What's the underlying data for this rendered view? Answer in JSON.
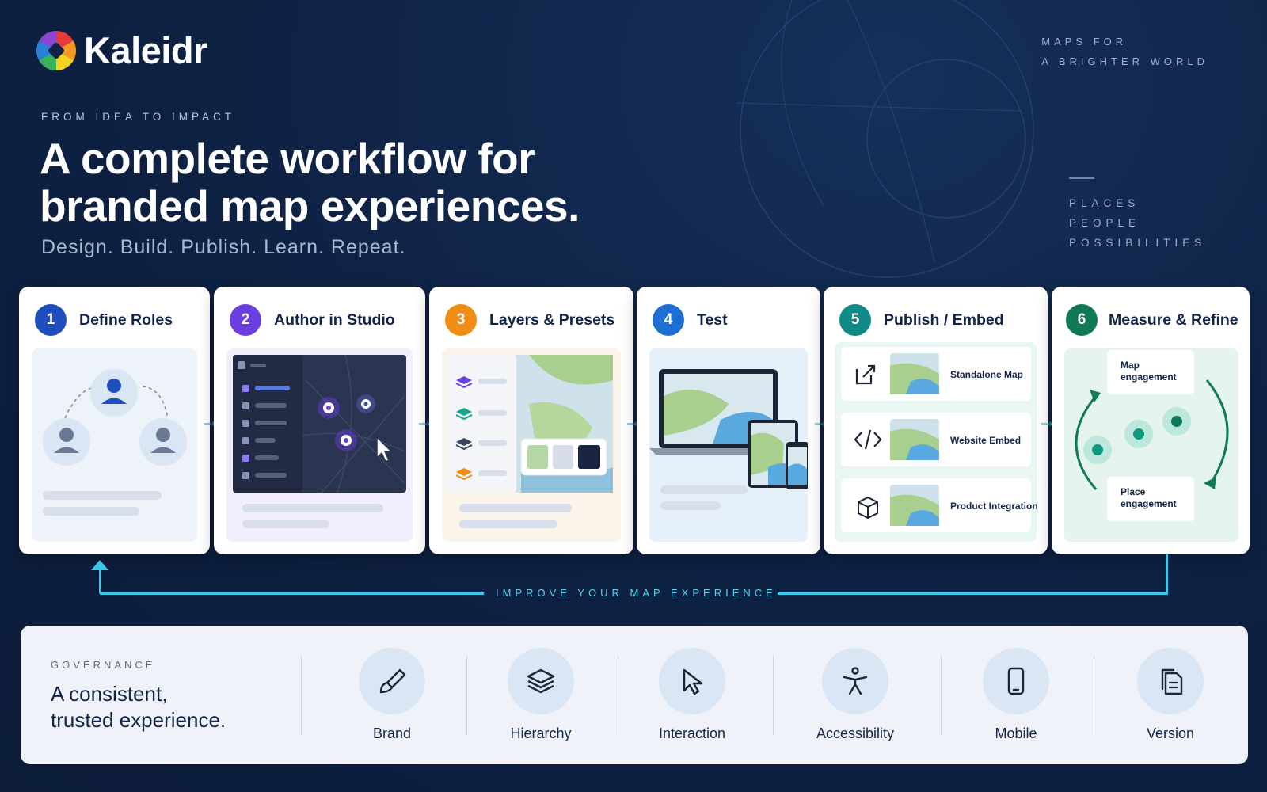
{
  "brand": {
    "name": "Kaleidr"
  },
  "tagline_right": [
    "MAPS FOR",
    "A BRIGHTER WORLD"
  ],
  "right_list": [
    "PLACES",
    "PEOPLE",
    "POSSIBILITIES"
  ],
  "hero": {
    "eyebrow": "FROM IDEA TO IMPACT",
    "headline_line1": "A complete workflow for",
    "headline_line2": "branded map experiences.",
    "subline": "Design. Build. Publish. Learn. Repeat."
  },
  "steps": [
    {
      "num": "1",
      "title": "Define Roles",
      "color": "#1f4fbf"
    },
    {
      "num": "2",
      "title": "Author in Studio",
      "color": "#6a3ee0"
    },
    {
      "num": "3",
      "title": "Layers & Presets",
      "color": "#ef8d14"
    },
    {
      "num": "4",
      "title": "Test",
      "color": "#1e6fd4"
    },
    {
      "num": "5",
      "title": "Publish / Embed",
      "color": "#0f8a86"
    },
    {
      "num": "6",
      "title": "Measure & Refine",
      "color": "#0f7a55"
    }
  ],
  "publish_options": [
    "Standalone Map",
    "Website Embed",
    "Product Integration"
  ],
  "measure": {
    "top_line1": "Map",
    "top_line2": "engagement",
    "bottom_line1": "Place",
    "bottom_line2": "engagement"
  },
  "loop_label": "IMPROVE YOUR MAP EXPERIENCE",
  "governance": {
    "eyebrow": "GOVERNANCE",
    "title_line1": "A consistent,",
    "title_line2": "trusted experience.",
    "items": [
      {
        "label": "Brand",
        "icon": "brush-icon"
      },
      {
        "label": "Hierarchy",
        "icon": "layers-icon"
      },
      {
        "label": "Interaction",
        "icon": "cursor-icon"
      },
      {
        "label": "Accessibility",
        "icon": "accessibility-icon"
      },
      {
        "label": "Mobile",
        "icon": "phone-icon"
      },
      {
        "label": "Version",
        "icon": "document-icon"
      }
    ]
  },
  "colors": {
    "background": "#0f2346",
    "accent_cyan": "#3ac8e8",
    "arrow_blue": "#2a86d6",
    "arrow_teal": "#17a89a"
  }
}
